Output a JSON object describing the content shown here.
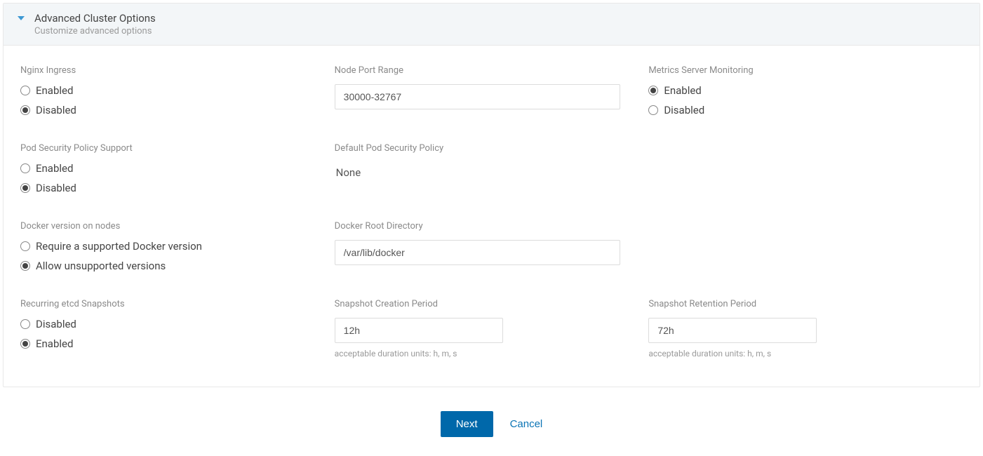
{
  "header": {
    "title": "Advanced Cluster Options",
    "subtitle": "Customize advanced options"
  },
  "nginx_ingress": {
    "label": "Nginx Ingress",
    "options": {
      "enabled": "Enabled",
      "disabled": "Disabled"
    },
    "selected": "disabled"
  },
  "node_port_range": {
    "label": "Node Port Range",
    "value": "30000-32767"
  },
  "metrics_server": {
    "label": "Metrics Server Monitoring",
    "options": {
      "enabled": "Enabled",
      "disabled": "Disabled"
    },
    "selected": "enabled"
  },
  "pod_security_support": {
    "label": "Pod Security Policy Support",
    "options": {
      "enabled": "Enabled",
      "disabled": "Disabled"
    },
    "selected": "disabled"
  },
  "default_psp": {
    "label": "Default Pod Security Policy",
    "value": "None"
  },
  "docker_version": {
    "label": "Docker version on nodes",
    "options": {
      "require": "Require a supported Docker version",
      "allow": "Allow unsupported versions"
    },
    "selected": "allow"
  },
  "docker_root": {
    "label": "Docker Root Directory",
    "value": "/var/lib/docker"
  },
  "etcd_snapshots": {
    "label": "Recurring etcd Snapshots",
    "options": {
      "disabled": "Disabled",
      "enabled": "Enabled"
    },
    "selected": "enabled"
  },
  "snapshot_creation": {
    "label": "Snapshot Creation Period",
    "value": "12h",
    "hint": "acceptable duration units: h, m, s"
  },
  "snapshot_retention": {
    "label": "Snapshot Retention Period",
    "value": "72h",
    "hint": "acceptable duration units: h, m, s"
  },
  "footer": {
    "next": "Next",
    "cancel": "Cancel"
  }
}
